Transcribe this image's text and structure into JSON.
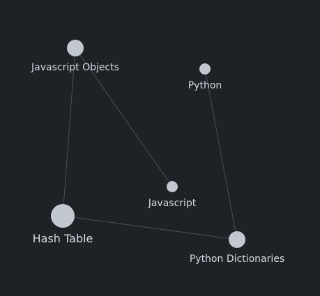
{
  "graph": {
    "nodes": [
      {
        "id": "js-objects",
        "label": "Javascript Objects"
      },
      {
        "id": "python",
        "label": "Python"
      },
      {
        "id": "javascript",
        "label": "Javascript"
      },
      {
        "id": "hash-table",
        "label": "Hash Table"
      },
      {
        "id": "python-dicts",
        "label": "Python Dictionaries"
      }
    ],
    "edges": [
      {
        "from": "js-objects",
        "to": "javascript"
      },
      {
        "from": "js-objects",
        "to": "hash-table"
      },
      {
        "from": "hash-table",
        "to": "python-dicts"
      },
      {
        "from": "python",
        "to": "python-dicts"
      }
    ]
  },
  "colors": {
    "background": "#1e2227",
    "node": "#c3c8cf",
    "edge": "#4a5058",
    "label": "#d6dae0"
  }
}
